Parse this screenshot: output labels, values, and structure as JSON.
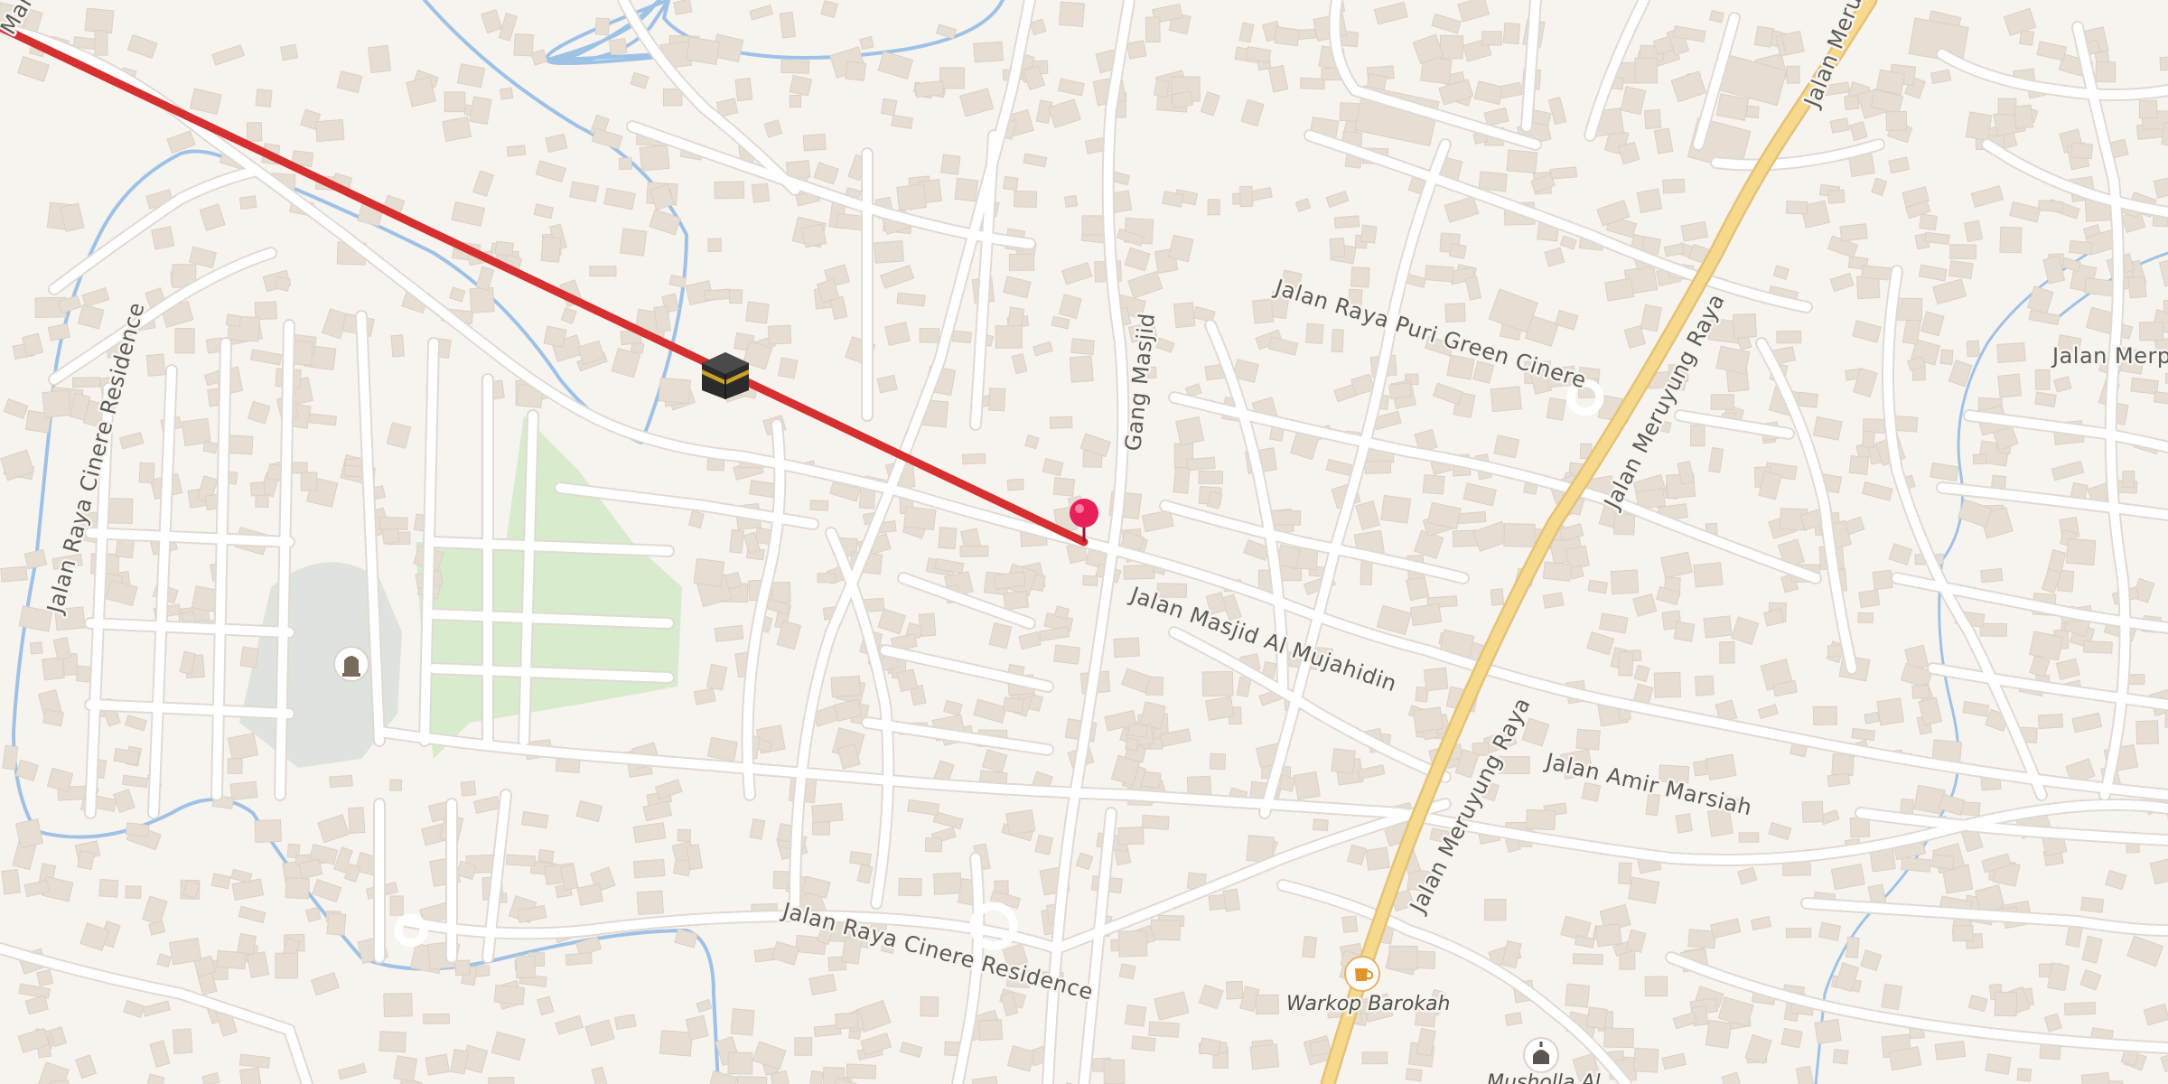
{
  "map": {
    "colors": {
      "background": "#f7f4f0",
      "road": "#ffffff",
      "main_road": "#f7d98b",
      "building": "#e6ddd3",
      "water": "#9ec2e6",
      "park": "#d9ebcd",
      "cemetery": "#dfe3de",
      "route_line": "#d62f2f",
      "pin": "#e8205a"
    },
    "streets": {
      "jalan_raya_puri_green_cinere": "Jalan Raya Puri Green Cinere",
      "gang_masjid": "Gang Masjid",
      "jalan_masjid_al_mujahidin": "Jalan Masjid Al Mujahidin",
      "jalan_amir_marsiah": "Jalan Amir Marsiah",
      "jalan_raya_cinere_residence_bottom": "Jalan Raya Cinere Residence",
      "jalan_raya_cinere_residence_left": "Jalan Raya Cinere Residence",
      "jalan_meruyung_raya_top": "Jalan Meruyung Raya",
      "jalan_meruyung_raya_mid": "Jalan Meruyung Raya",
      "jalan_meruyung_raya_bottom": "Jalan Meruyung Raya",
      "jalan_merp": "Jalan Merp",
      "jalan_marus": "Marus"
    },
    "pois": {
      "warkop_barokah": "Warkop Barokah",
      "musholla": "Musholla Al"
    },
    "icons": {
      "kaaba": "kaaba-icon",
      "pin": "location-pin-icon",
      "cemetery": "cemetery-icon",
      "cafe": "cafe-icon",
      "mosque": "mosque-icon"
    }
  }
}
